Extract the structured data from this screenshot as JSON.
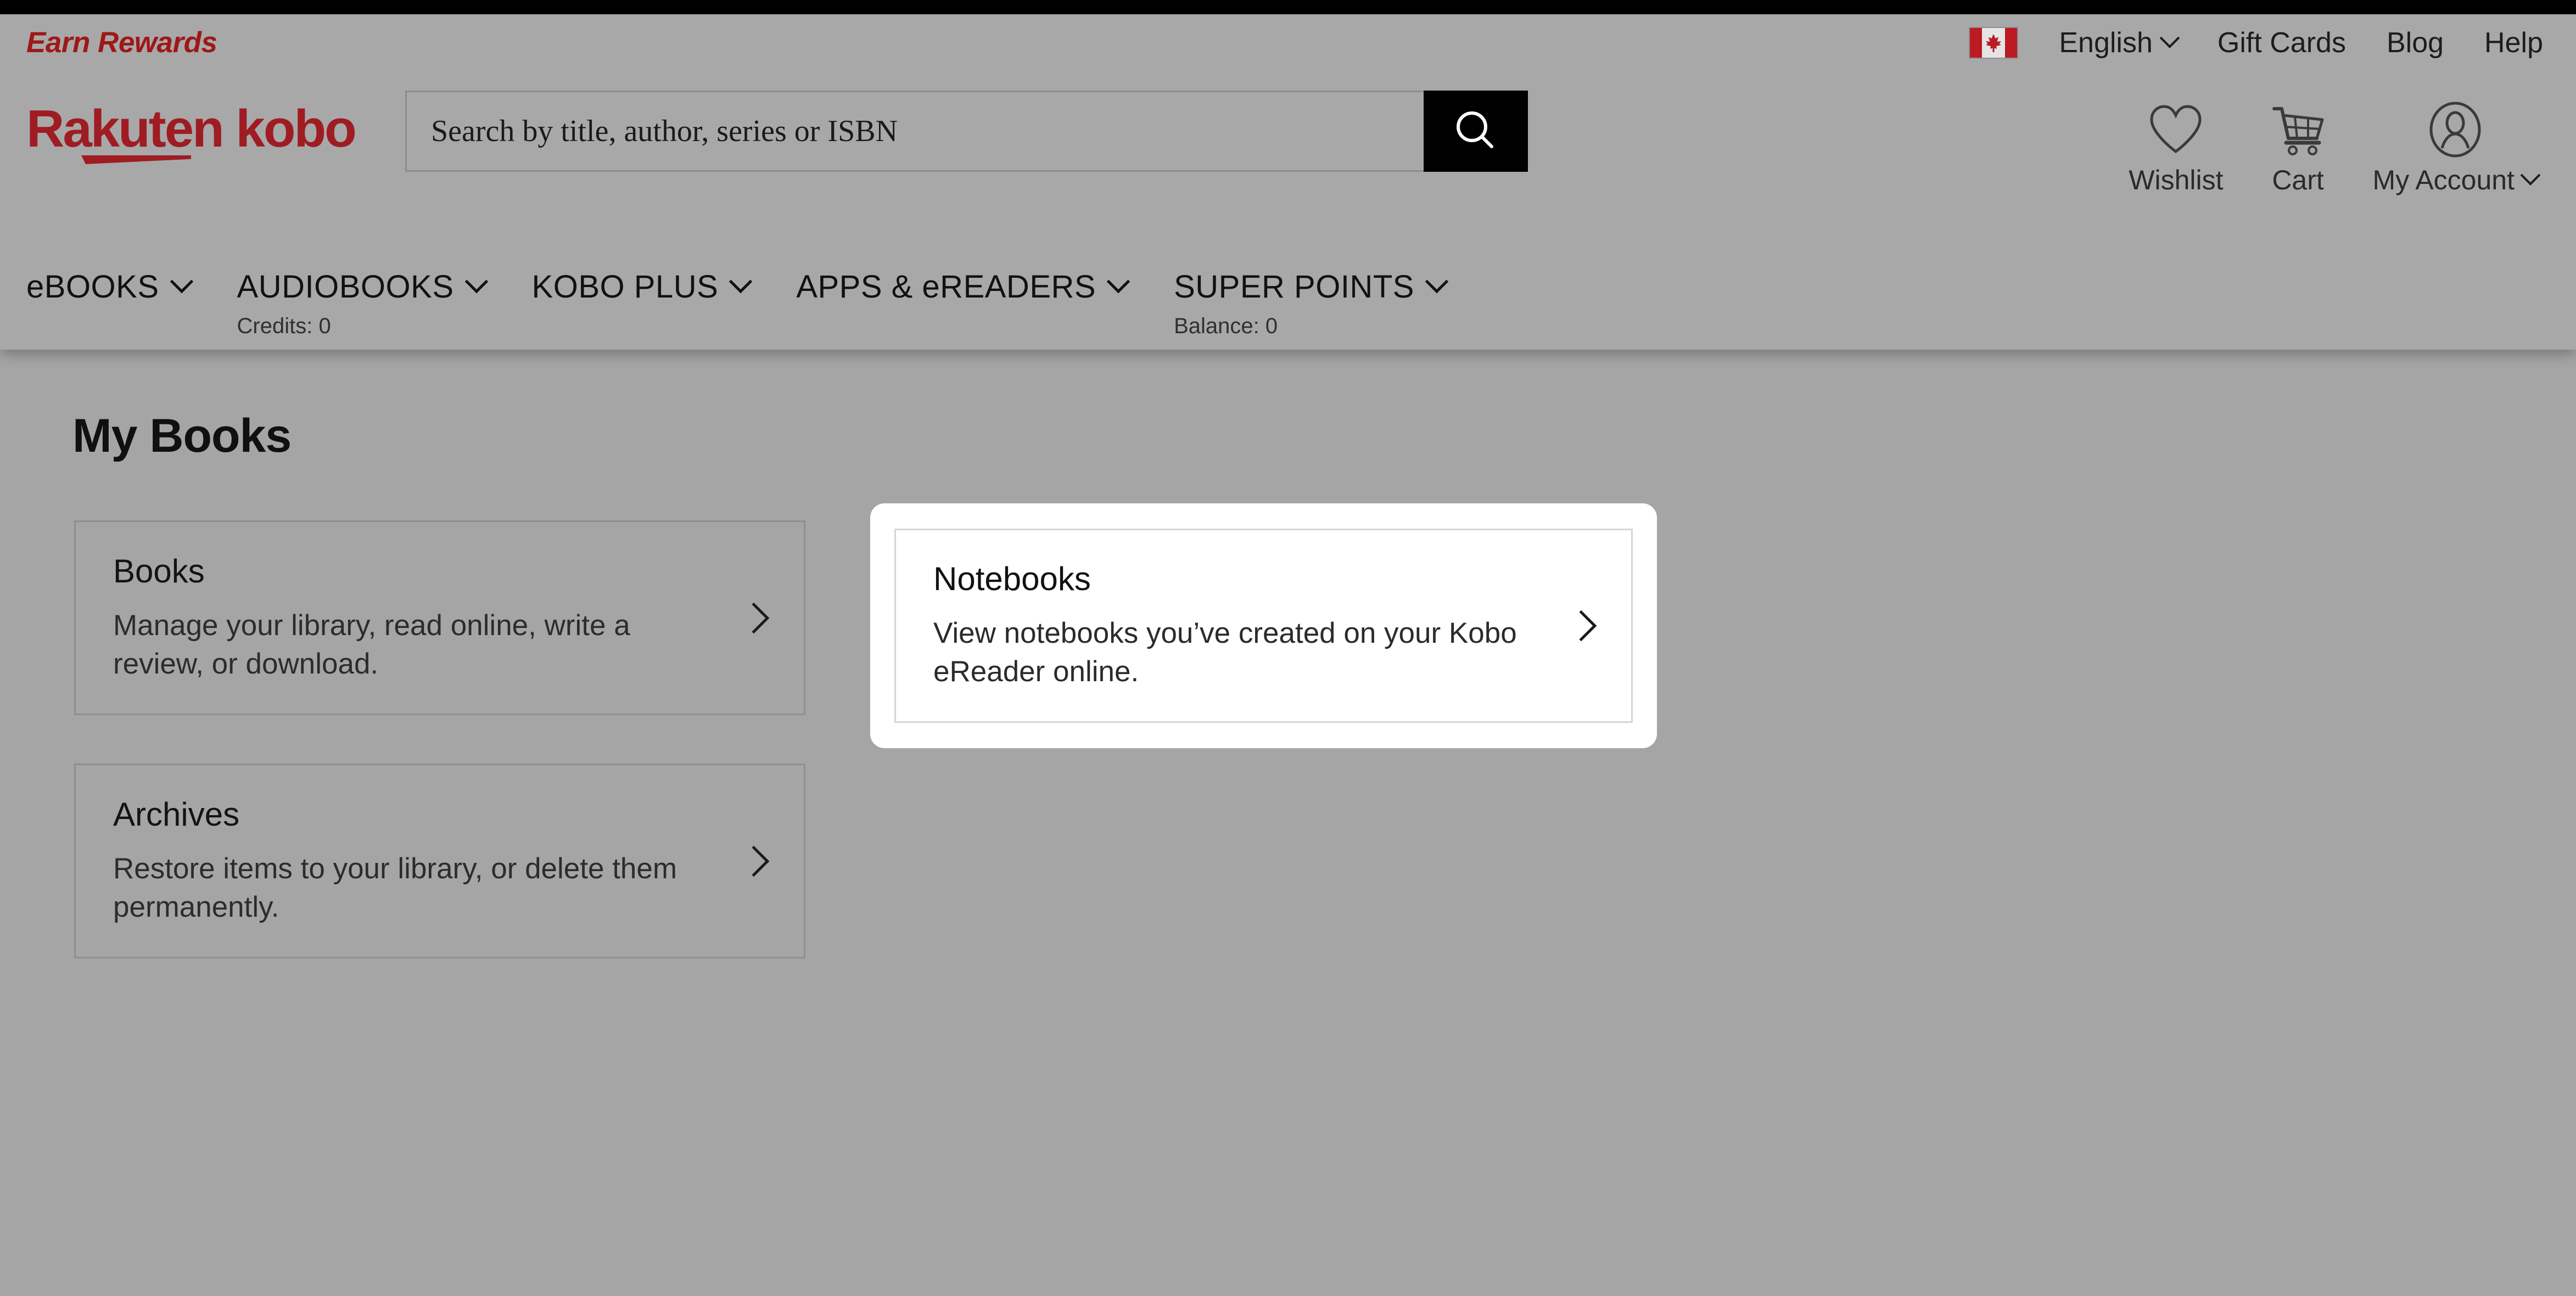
{
  "topbar": {
    "earn_rewards_label": "Earn Rewards",
    "flag_icon": "canada-flag-icon",
    "language_label": "English",
    "gift_cards_label": "Gift Cards",
    "blog_label": "Blog",
    "help_label": "Help"
  },
  "brand": {
    "logo_text": "Rakuten kobo",
    "logo_color": "#9f1c23"
  },
  "search": {
    "placeholder": "Search by title, author, series or ISBN",
    "value": "",
    "button_icon": "search-icon",
    "button_bg": "#000000"
  },
  "actions": [
    {
      "label": "Wishlist",
      "icon": "heart-icon",
      "has_chevron": false
    },
    {
      "label": "Cart",
      "icon": "cart-icon",
      "has_chevron": false
    },
    {
      "label": "My Account",
      "icon": "user-circle-icon",
      "has_chevron": true
    }
  ],
  "nav": [
    {
      "label": "eBOOKS",
      "sub": ""
    },
    {
      "label": "AUDIOBOOKS",
      "sub": "Credits: 0"
    },
    {
      "label": "KOBO PLUS",
      "sub": ""
    },
    {
      "label": "APPS & eREADERS",
      "sub": ""
    },
    {
      "label": "SUPER POINTS",
      "sub": "Balance: 0"
    }
  ],
  "page": {
    "title": "My Books"
  },
  "tiles": {
    "books": {
      "title": "Books",
      "desc": "Manage your library, read online, write a review, or download.",
      "arrow_icon": "chevron-right-icon"
    },
    "archives": {
      "title": "Archives",
      "desc": "Restore items to your library, or delete them permanently.",
      "arrow_icon": "chevron-right-icon"
    },
    "notebooks": {
      "title": "Notebooks",
      "desc": "View notebooks you’ve created on your Kobo eReader online.",
      "arrow_icon": "chevron-right-icon",
      "highlighted": true,
      "highlight_bg": "#ffffff"
    }
  }
}
